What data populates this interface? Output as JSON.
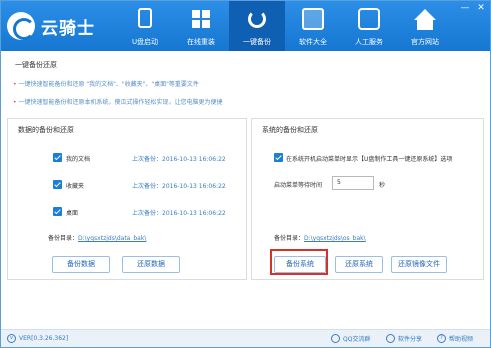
{
  "app": {
    "name": "云骑士",
    "window_controls": [
      "—",
      "✕"
    ]
  },
  "nav": {
    "tabs": [
      {
        "label": "U盘启动",
        "icon": "usb-drive-icon"
      },
      {
        "label": "在线重装",
        "icon": "windows-icon"
      },
      {
        "label": "一键备份",
        "icon": "refresh-backup-icon",
        "active": true
      },
      {
        "label": "软件大全",
        "icon": "shopping-bag-icon"
      },
      {
        "label": "人工服务",
        "icon": "chat-service-icon"
      },
      {
        "label": "官方网站",
        "icon": "home-icon"
      }
    ]
  },
  "intro": {
    "title": "一键备份还原",
    "lines": [
      "一键快速智能备份和还原 \"我的文档\"、\"收藏夹\"、\"桌面\"等重要文件",
      "一键快速智能备份和还原本机系统，傻瓜式操作轻松实现，让您电脑更为便捷"
    ]
  },
  "data_panel": {
    "title": "数据的备份和还原",
    "rows": [
      {
        "label": "我的文档",
        "time": "上次备份：2016-10-13 16:06:22"
      },
      {
        "label": "收藏夹",
        "time": "上次备份：2016-10-13 16:06:22"
      },
      {
        "label": "桌面",
        "time": "上次备份：2016-10-13 16:06:22"
      }
    ],
    "dir_label": "备份目录：",
    "dir_path": "D:\\yqsxtzjds\\data_bak\\",
    "backup_button": "备份数据",
    "restore_button": "还原数据"
  },
  "system_panel": {
    "title": "系统的备份和还原",
    "checkbox_label": "在系统开机启动菜单时显示【U盘制作工具一键还原系统】选项",
    "wait_label": "启动菜单等待时间",
    "wait_value": "5",
    "wait_unit": "秒",
    "dir_label": "备份目录：",
    "dir_path": "D:\\yqsxtzjds\\os_bak\\",
    "backup_button": "备份系统",
    "restore_button": "还原系统",
    "restore_image_button": "还原镜像文件"
  },
  "status": {
    "version": "VER[0.3.26.362]",
    "qq_group": "QQ交流群",
    "share": "软件分享",
    "help": "帮助视频"
  }
}
